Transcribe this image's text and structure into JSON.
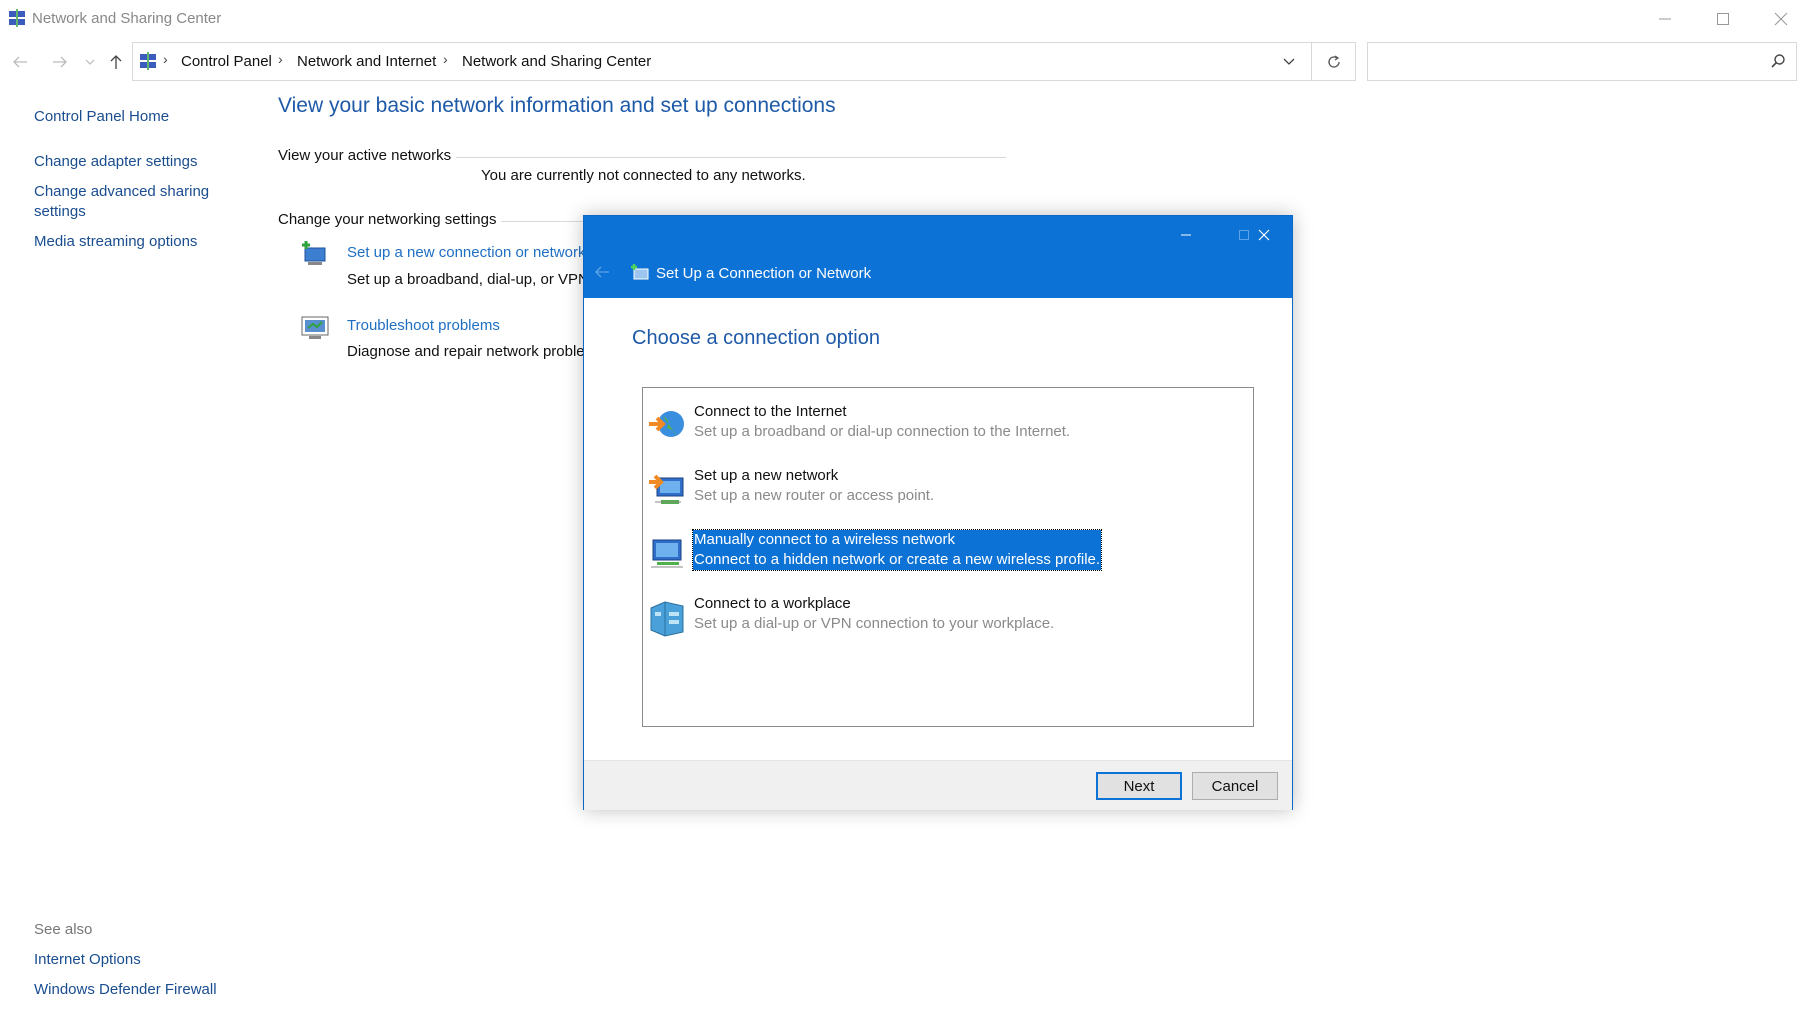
{
  "window": {
    "title": "Network and Sharing Center",
    "icon": "network-center-icon"
  },
  "address": {
    "breadcrumbs": [
      "Control Panel",
      "Network and Internet",
      "Network and Sharing Center"
    ],
    "search_placeholder": ""
  },
  "sidebar": {
    "home": "Control Panel Home",
    "links": [
      "Change adapter settings",
      "Change advanced sharing",
      "settings",
      "Media streaming options"
    ],
    "see_also_label": "See also",
    "see_also": [
      "Internet Options",
      "Windows Defender Firewall"
    ]
  },
  "main": {
    "title": "View your basic network information and set up connections",
    "active_networks_label": "View your active networks",
    "not_connected": "You are currently not connected to any networks.",
    "change_settings_label": "Change your networking settings",
    "setup_link": "Set up a new connection or network",
    "setup_desc": "Set up a broadband, dial-up, or VPN",
    "troubleshoot_link": "Troubleshoot problems",
    "troubleshoot_desc": "Diagnose and repair network proble"
  },
  "dialog": {
    "title": "Set Up a Connection or Network",
    "heading": "Choose a connection option",
    "options": [
      {
        "title": "Connect to the Internet",
        "desc": "Set up a broadband or dial-up connection to the Internet.",
        "icon": "globe-icon",
        "selected": false
      },
      {
        "title": "Set up a new network",
        "desc": "Set up a new router or access point.",
        "icon": "router-icon",
        "selected": false
      },
      {
        "title": "Manually connect to a wireless network",
        "desc": "Connect to a hidden network or create a new wireless profile.",
        "icon": "wireless-icon",
        "selected": true
      },
      {
        "title": "Connect to a workplace",
        "desc": "Set up a dial-up or VPN connection to your workplace.",
        "icon": "workplace-icon",
        "selected": false
      }
    ],
    "next_label": "Next",
    "cancel_label": "Cancel"
  },
  "colors": {
    "accent": "#0c72d5",
    "link": "#1e6fc4",
    "title_blue": "#1e5aa8"
  }
}
